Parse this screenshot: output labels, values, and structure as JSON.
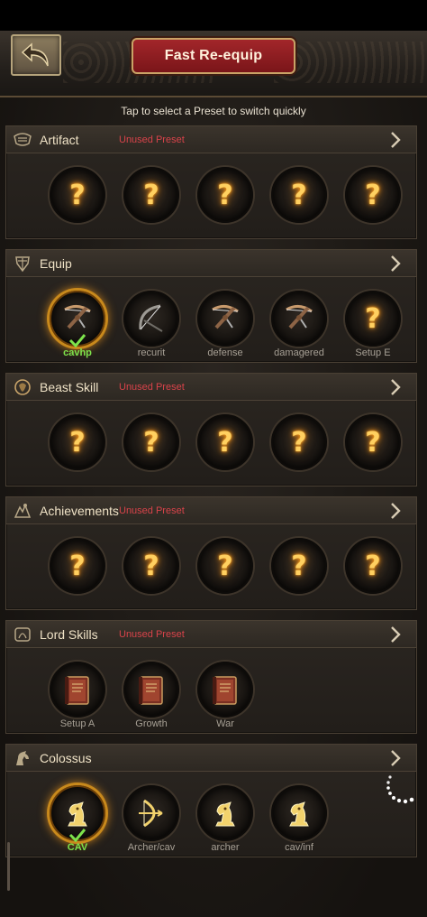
{
  "header": {
    "title": "Fast Re-equip",
    "hint": "Tap to select a Preset to switch quickly"
  },
  "colors": {
    "accent": "#c8891c",
    "unused": "#d8434a",
    "active_label": "#7de34c",
    "title_plate": "#a2262a"
  },
  "sections": [
    {
      "title": "Artifact",
      "icon": "artifact-icon",
      "unused": "Unused Preset",
      "slots": [
        {
          "icon": "question-mark",
          "label": ""
        },
        {
          "icon": "question-mark",
          "label": ""
        },
        {
          "icon": "question-mark",
          "label": ""
        },
        {
          "icon": "question-mark",
          "label": ""
        },
        {
          "icon": "question-mark",
          "label": ""
        }
      ]
    },
    {
      "title": "Equip",
      "icon": "armor-icon",
      "unused": "",
      "slots": [
        {
          "icon": "crossbow",
          "label": "cavhp",
          "selected": true
        },
        {
          "icon": "bow",
          "label": "recurit"
        },
        {
          "icon": "crossbow",
          "label": "defense"
        },
        {
          "icon": "crossbow",
          "label": "damagered"
        },
        {
          "icon": "question-mark",
          "label": "Setup E"
        }
      ]
    },
    {
      "title": "Beast Skill",
      "icon": "beast-icon",
      "unused": "Unused Preset",
      "slots": [
        {
          "icon": "question-mark",
          "label": ""
        },
        {
          "icon": "question-mark",
          "label": ""
        },
        {
          "icon": "question-mark",
          "label": ""
        },
        {
          "icon": "question-mark",
          "label": ""
        },
        {
          "icon": "question-mark",
          "label": ""
        }
      ]
    },
    {
      "title": "Achievements",
      "icon": "achievement-icon",
      "unused": "Unused Preset",
      "slots": [
        {
          "icon": "question-mark",
          "label": ""
        },
        {
          "icon": "question-mark",
          "label": ""
        },
        {
          "icon": "question-mark",
          "label": ""
        },
        {
          "icon": "question-mark",
          "label": ""
        },
        {
          "icon": "question-mark",
          "label": ""
        }
      ]
    },
    {
      "title": "Lord Skills",
      "icon": "lord-skill-icon",
      "unused": "Unused Preset",
      "slots": [
        {
          "icon": "book",
          "label": "Setup A"
        },
        {
          "icon": "book",
          "label": "Growth"
        },
        {
          "icon": "book",
          "label": "War"
        }
      ]
    },
    {
      "title": "Colossus",
      "icon": "horse-icon",
      "unused": "",
      "slots": [
        {
          "icon": "knight",
          "label": "CAV",
          "selected": true
        },
        {
          "icon": "bow-cav",
          "label": "Archer/cav"
        },
        {
          "icon": "knight",
          "label": "archer"
        },
        {
          "icon": "knight",
          "label": "cav/inf"
        }
      ]
    }
  ]
}
